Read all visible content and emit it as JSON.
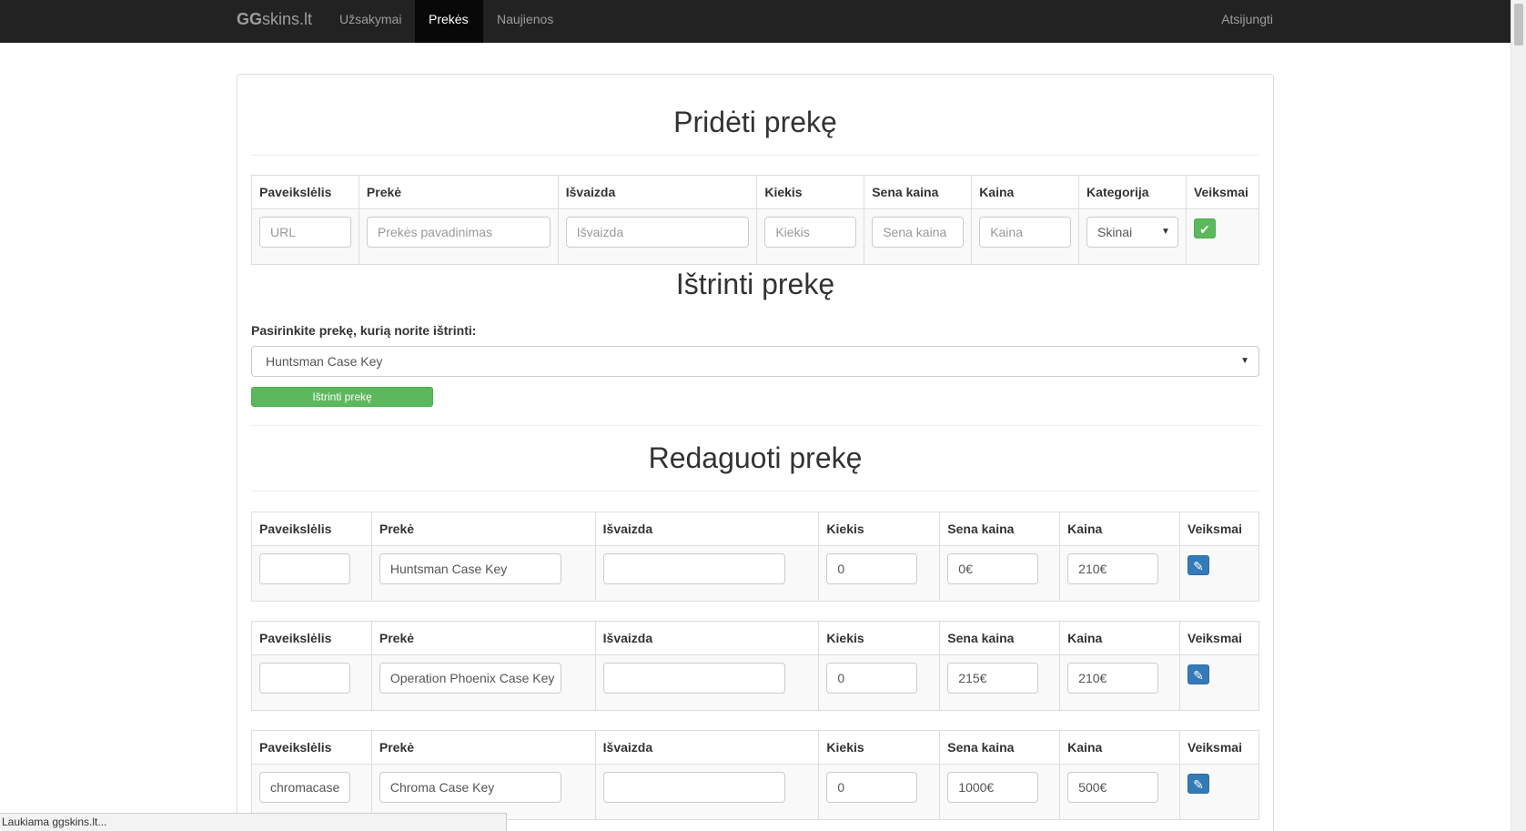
{
  "navbar": {
    "brand_bold": "GG",
    "brand_rest": "skins.lt",
    "links": [
      {
        "label": "Užsakymai",
        "active": false
      },
      {
        "label": "Prekės",
        "active": true
      },
      {
        "label": "Naujienos",
        "active": false
      }
    ],
    "logout_label": "Atsijungti"
  },
  "add_section": {
    "title": "Pridėti prekę",
    "headers": [
      "Paveikslėlis",
      "Prekė",
      "Išvaizda",
      "Kiekis",
      "Sena kaina",
      "Kaina",
      "Kategorija",
      "Veiksmai"
    ],
    "placeholders": {
      "image": "URL",
      "name": "Prekės pavadinimas",
      "appearance": "Išvaizda",
      "quantity": "Kiekis",
      "old_price": "Sena kaina",
      "price": "Kaina"
    },
    "category_selected": "Skinai",
    "submit_icon": "check-icon"
  },
  "delete_section": {
    "title": "Ištrinti prekę",
    "label": "Pasirinkite prekę, kurią norite ištrinti:",
    "selected": "Huntsman Case Key",
    "button_label": "Ištrinti prekę"
  },
  "edit_section": {
    "title": "Redaguoti prekę",
    "headers": [
      "Paveikslėlis",
      "Prekė",
      "Išvaizda",
      "Kiekis",
      "Sena kaina",
      "Kaina",
      "Veiksmai"
    ],
    "items": [
      {
        "image": "",
        "name": "Huntsman Case Key",
        "appearance": "",
        "quantity": "0",
        "old_price": "0€",
        "price": "210€"
      },
      {
        "image": "",
        "name": "Operation Phoenix Case Key",
        "appearance": "",
        "quantity": "0",
        "old_price": "215€",
        "price": "210€"
      },
      {
        "image": "chromacase",
        "name": "Chroma Case Key",
        "appearance": "",
        "quantity": "0",
        "old_price": "1000€",
        "price": "500€"
      }
    ],
    "edit_icon": "pencil-icon"
  },
  "statusbar": {
    "text": "Laukiama ggskins.lt..."
  },
  "colors": {
    "navbar_bg": "#222222",
    "success": "#5cb85c",
    "primary": "#337ab7"
  }
}
